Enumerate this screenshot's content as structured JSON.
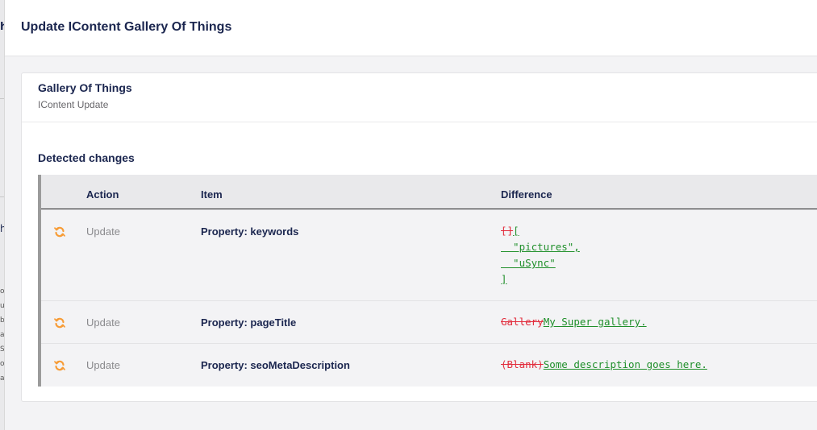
{
  "window": {
    "title": "Update IContent Gallery Of Things"
  },
  "backdrop": {
    "fragments": [
      "h",
      "h",
      "ot",
      "u",
      "b",
      "a",
      "Sc",
      "o",
      "a"
    ]
  },
  "card": {
    "title": "Gallery Of Things",
    "subtitle": "IContent Update",
    "section_title": "Detected changes"
  },
  "table": {
    "headers": {
      "action": "Action",
      "item": "Item",
      "difference": "Difference"
    },
    "rows": [
      {
        "icon": "sync-icon",
        "action": "Update",
        "item": "Property: keywords",
        "diff_removed": "[]",
        "diff_added_lines": [
          "[",
          "  \"pictures\",",
          "  \"uSync\"",
          "]"
        ]
      },
      {
        "icon": "sync-icon",
        "action": "Update",
        "item": "Property: pageTitle",
        "diff_removed": "Gallery",
        "diff_added": "My Super gallery."
      },
      {
        "icon": "sync-icon",
        "action": "Update",
        "item": "Property: seoMetaDescription",
        "diff_removed": "(Blank)",
        "diff_added": "Some description goes here."
      }
    ]
  },
  "colors": {
    "accent_icon": "#f79c37",
    "removed": "#e22c3c",
    "added": "#1f8f2a",
    "text_primary": "#1b264f"
  }
}
